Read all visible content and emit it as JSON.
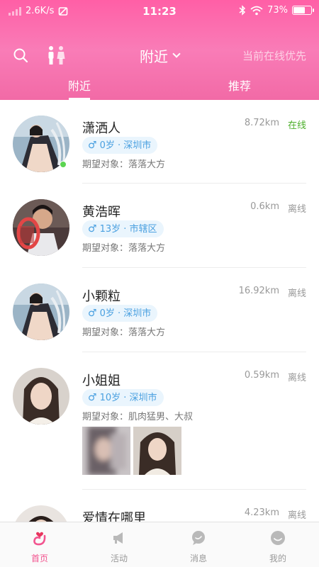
{
  "status_bar": {
    "speed": "2.6K/s",
    "time": "11:23",
    "battery_text": "73%",
    "battery_level": 0.73
  },
  "header": {
    "title": "附近",
    "online_first": "当前在线优先",
    "tabs": [
      {
        "label": "附近",
        "active": true
      },
      {
        "label": "推荐",
        "active": false
      }
    ]
  },
  "users": [
    {
      "name": "潇洒人",
      "distance": "8.72km",
      "status": "在线",
      "online": true,
      "tag": "0岁 · 深圳市",
      "gender_symbol": "♂",
      "expect": "期望对象：落落大方"
    },
    {
      "name": "黄浩晖",
      "distance": "0.6km",
      "status": "离线",
      "online": false,
      "tag": "13岁 · 市辖区",
      "gender_symbol": "♂",
      "expect": "期望对象：落落大方"
    },
    {
      "name": "小颗粒",
      "distance": "16.92km",
      "status": "离线",
      "online": false,
      "tag": "0岁 · 深圳市",
      "gender_symbol": "♂",
      "expect": "期望对象：落落大方"
    },
    {
      "name": "小姐姐",
      "distance": "0.59km",
      "status": "离线",
      "online": false,
      "tag": "10岁 · 深圳市",
      "gender_symbol": "♂",
      "expect": "期望对象：肌肉猛男、大叔"
    },
    {
      "name": "爱情在哪里",
      "distance": "4.23km",
      "status": "离线",
      "online": false
    }
  ],
  "tabbar": {
    "items": [
      {
        "label": "首页",
        "icon": "home-heart-icon",
        "active": true
      },
      {
        "label": "活动",
        "icon": "megaphone-icon",
        "active": false
      },
      {
        "label": "消息",
        "icon": "chat-bubble-icon",
        "active": false
      },
      {
        "label": "我的",
        "icon": "smiley-icon",
        "active": false
      }
    ]
  },
  "colors": {
    "brand_pink": "#ff5fa6",
    "online_green": "#4caf2a",
    "tag_blue": "#4aa0e0",
    "tag_bg": "#eaf5fd"
  }
}
